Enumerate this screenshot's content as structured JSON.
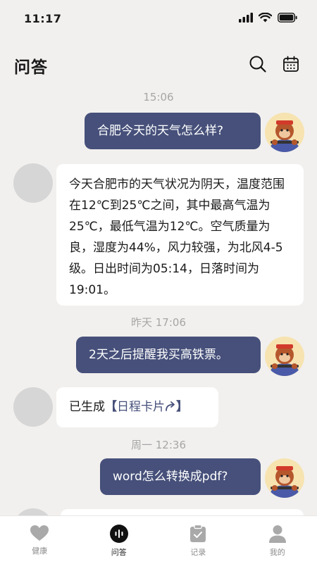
{
  "status": {
    "time": "11:17"
  },
  "header": {
    "title": "问答"
  },
  "chat": {
    "ts1": "15:06",
    "msg1": "合肥今天的天气怎么样?",
    "reply1": "今天合肥市的天气状况为阴天，温度范围在12℃到25℃之间，其中最高气温为25℃，最低气温为12℃。空气质量为良，湿度为44%，风力较强，为北风4-5级。日出时间为05:14，日落时间为19:01。",
    "ts2": "昨天 17:06",
    "msg2": "2天之后提醒我买高铁票。",
    "reply2_prefix": "已生成",
    "reply2_bracket_open": "【",
    "reply2_link": "日程卡片",
    "reply2_bracket_close": "】",
    "ts3": "周一 12:36",
    "msg3": "word怎么转换成pdf?"
  },
  "tabs": [
    {
      "label": "健康",
      "icon": "heart-icon"
    },
    {
      "label": "问答",
      "icon": "voice-wave-icon"
    },
    {
      "label": "记录",
      "icon": "clipboard-check-icon"
    },
    {
      "label": "我的",
      "icon": "person-icon"
    }
  ],
  "colors": {
    "accent": "#46507a",
    "background": "#f2f0ee",
    "bubble_bot": "#ffffff"
  }
}
